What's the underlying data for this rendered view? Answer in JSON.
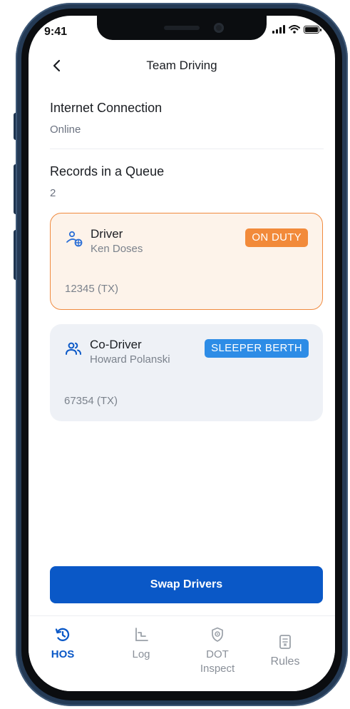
{
  "status_bar": {
    "time": "9:41"
  },
  "header": {
    "title": "Team Driving",
    "back_icon": "chevron-left-icon"
  },
  "internet": {
    "label": "Internet Connection",
    "value": "Online"
  },
  "queue": {
    "label": "Records in a Queue",
    "value": "2"
  },
  "drivers": [
    {
      "role": "Driver",
      "name": "Ken Doses",
      "status": "ON DUTY",
      "status_color": "#f28a3a",
      "license": "12345 (TX)",
      "icon": "driver-icon",
      "selected": true
    },
    {
      "role": "Co-Driver",
      "name": "Howard Polanski",
      "status": "SLEEPER BERTH",
      "status_color": "#2d8ce6",
      "license": "67354 (TX)",
      "icon": "co-driver-icon",
      "selected": false
    }
  ],
  "actions": {
    "swap_label": "Swap Drivers"
  },
  "tabs": [
    {
      "label": "HOS",
      "icon": "history-icon",
      "active": true
    },
    {
      "label": "Log",
      "icon": "log-chart-icon",
      "active": false
    },
    {
      "label": "DOT\nInspect",
      "icon": "inspect-icon",
      "active": false
    },
    {
      "label": "Rules",
      "icon": "rules-icon",
      "active": false
    }
  ],
  "colors": {
    "accent": "#0a58c7",
    "on_duty": "#f28a3a",
    "sleeper": "#2d8ce6"
  }
}
